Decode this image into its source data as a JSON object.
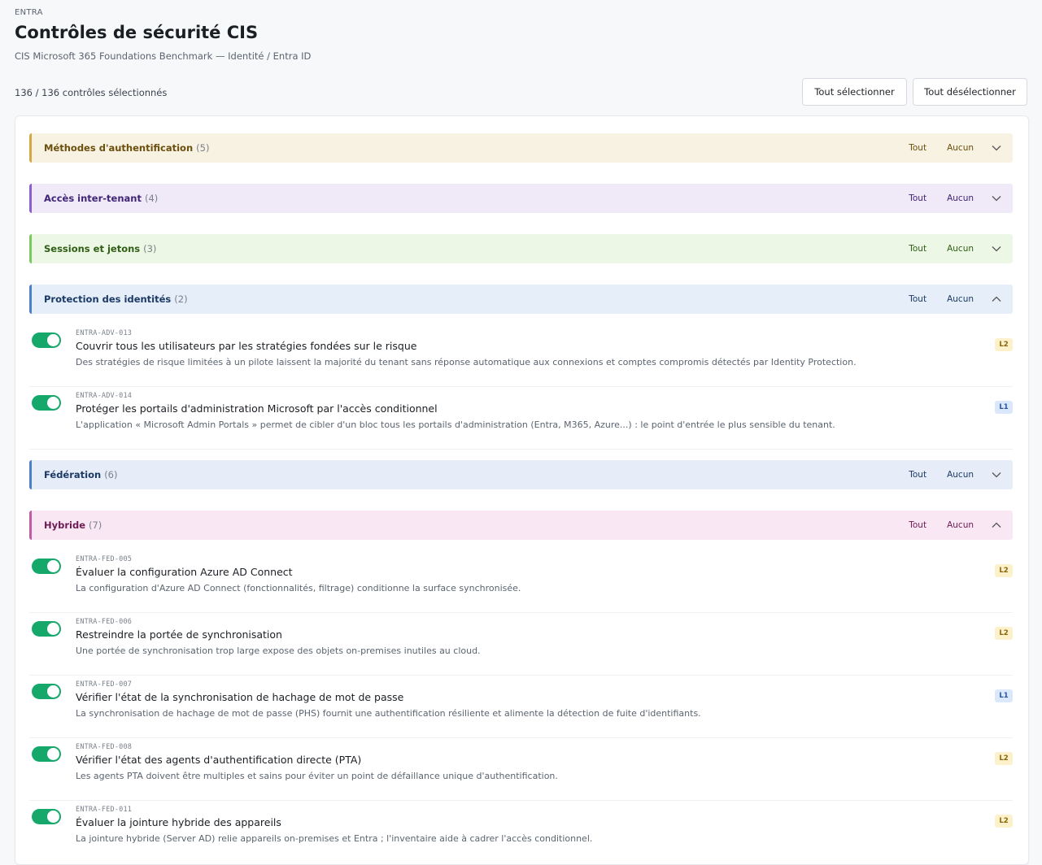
{
  "header": {
    "eyebrow": "ENTRA",
    "title": "Contrôles de sécurité CIS",
    "subtitle": "CIS Microsoft 365 Foundations Benchmark — Identité / Entra ID",
    "selection_count": "136 / 136 contrôles sélectionnés",
    "select_all_label": "Tout sélectionner",
    "deselect_all_label": "Tout désélectionner"
  },
  "group_actions": {
    "all_label": "Tout",
    "none_label": "Aucun"
  },
  "groups": [
    {
      "name": "Méthodes d'authentification",
      "count": "(5)",
      "expanded": false,
      "color": "#d4a843"
    },
    {
      "name": "Accès inter-tenant",
      "count": "(4)",
      "expanded": false,
      "color": "#8a5fd0"
    },
    {
      "name": "Sessions et jetons",
      "count": "(3)",
      "expanded": false,
      "color": "#7cc95b"
    },
    {
      "name": "Protection des identités",
      "count": "(2)",
      "expanded": true,
      "color": "#4b7fc9",
      "items": [
        {
          "id": "ENTRA-ADV-013",
          "title": "Couvrir tous les utilisateurs par les stratégies fondées sur le risque",
          "description": "Des stratégies de risque limitées à un pilote laissent la majorité du tenant sans réponse automatique aux connexions et comptes compromis détectés par Identity Protection.",
          "level": "L2",
          "enabled": true
        },
        {
          "id": "ENTRA-ADV-014",
          "title": "Protéger les portails d'administration Microsoft par l'accès conditionnel",
          "description": "L'application « Microsoft Admin Portals » permet de cibler d'un bloc tous les portails d'administration (Entra, M365, Azure...) : le point d'entrée le plus sensible du tenant.",
          "level": "L1",
          "enabled": true
        }
      ]
    },
    {
      "name": "Fédération",
      "count": "(6)",
      "expanded": false,
      "color": "#4b7fc9"
    },
    {
      "name": "Hybride",
      "count": "(7)",
      "expanded": true,
      "color": "#c45aa6",
      "items": [
        {
          "id": "ENTRA-FED-005",
          "title": "Évaluer la configuration Azure AD Connect",
          "description": "La configuration d'Azure AD Connect (fonctionnalités, filtrage) conditionne la surface synchronisée.",
          "level": "L2",
          "enabled": true
        },
        {
          "id": "ENTRA-FED-006",
          "title": "Restreindre la portée de synchronisation",
          "description": "Une portée de synchronisation trop large expose des objets on-premises inutiles au cloud.",
          "level": "L2",
          "enabled": true
        },
        {
          "id": "ENTRA-FED-007",
          "title": "Vérifier l'état de la synchronisation de hachage de mot de passe",
          "description": "La synchronisation de hachage de mot de passe (PHS) fournit une authentification résiliente et alimente la détection de fuite d'identifiants.",
          "level": "L1",
          "enabled": true
        },
        {
          "id": "ENTRA-FED-008",
          "title": "Vérifier l'état des agents d'authentification directe (PTA)",
          "description": "Les agents PTA doivent être multiples et sains pour éviter un point de défaillance unique d'authentification.",
          "level": "L2",
          "enabled": true
        },
        {
          "id": "ENTRA-FED-011",
          "title": "Évaluer la jointure hybride des appareils",
          "description": "La jointure hybride (Server AD) relie appareils on-premises et Entra ; l'inventaire aide à cadrer l'accès conditionnel.",
          "level": "L2",
          "enabled": true
        }
      ]
    }
  ]
}
